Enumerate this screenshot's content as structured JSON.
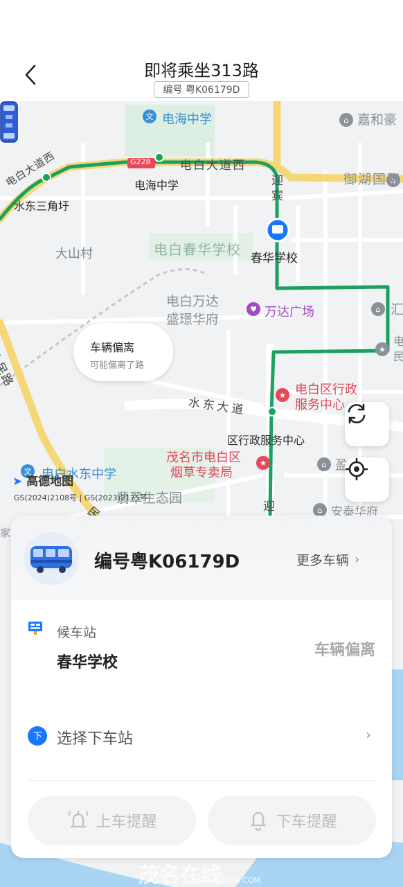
{
  "header": {
    "title": "即将乘坐313路",
    "plate_badge": "编号 粤K06179D"
  },
  "map": {
    "labels": {
      "dianhai_school_poi": "电海中学",
      "jiahe": "嘉和豪",
      "g228": "G228",
      "dianbai_road_west": "电白大道西",
      "dianhai_stop": "电海中学",
      "yuhu": "御湖国际",
      "dianbai_road_left": "电白大道西",
      "shuidong_triangle": "水东三角圩",
      "yingbin_top": "迎宾",
      "dashan": "大山村",
      "chunhua_campus": "电白春华学校",
      "chunhua_stop": "春华学校",
      "wanda_area_line1": "电白万达",
      "wanda_area_line2": "盛璟华府",
      "wanda_plaza": "万达广场",
      "hui": "汇",
      "dian_right": "电民",
      "renmin_road": "人民路",
      "shuidong_avenue": "水东大道",
      "gov_center_poi_line1": "电白区行政",
      "gov_center_poi_line2": "服务中心",
      "gov_center_stop": "区行政服务中心",
      "maoming_tobacco_line1": "茂名市电白区",
      "maoming_tobacco_line2": "烟草专卖局",
      "ying_poi": "盈",
      "shuidong_school": "电白水东中学",
      "jade_park": "翡翠生态园",
      "ying_bottom": "迎",
      "antai": "安泰华府",
      "jia": "家",
      "min_road": "民"
    },
    "deviation_bubble": {
      "title": "车辆偏离",
      "subtitle": "可能偏离了路"
    },
    "amap_logo": "高德地图",
    "copyright": "GS(2024)2108号 | GS(2023)2175号"
  },
  "card": {
    "plate": "编号粤K06179D",
    "more_vehicles": "更多车辆",
    "waiting_stop_label": "候车站",
    "waiting_stop_name": "春华学校",
    "status": "车辆偏离",
    "select_alight_badge": "下",
    "select_alight_label": "选择下车站",
    "boarding_reminder": "上车提醒",
    "alighting_reminder": "下车提醒"
  },
  "watermark": {
    "text": "茂名在线",
    "url": "WWW.GDMM.COM"
  },
  "colors": {
    "route_green": "#1aa061",
    "road_yellow": "#f5d778",
    "accent_blue": "#1677ff",
    "poi_red": "#e8495a",
    "status_gray": "#a9a9a9"
  }
}
